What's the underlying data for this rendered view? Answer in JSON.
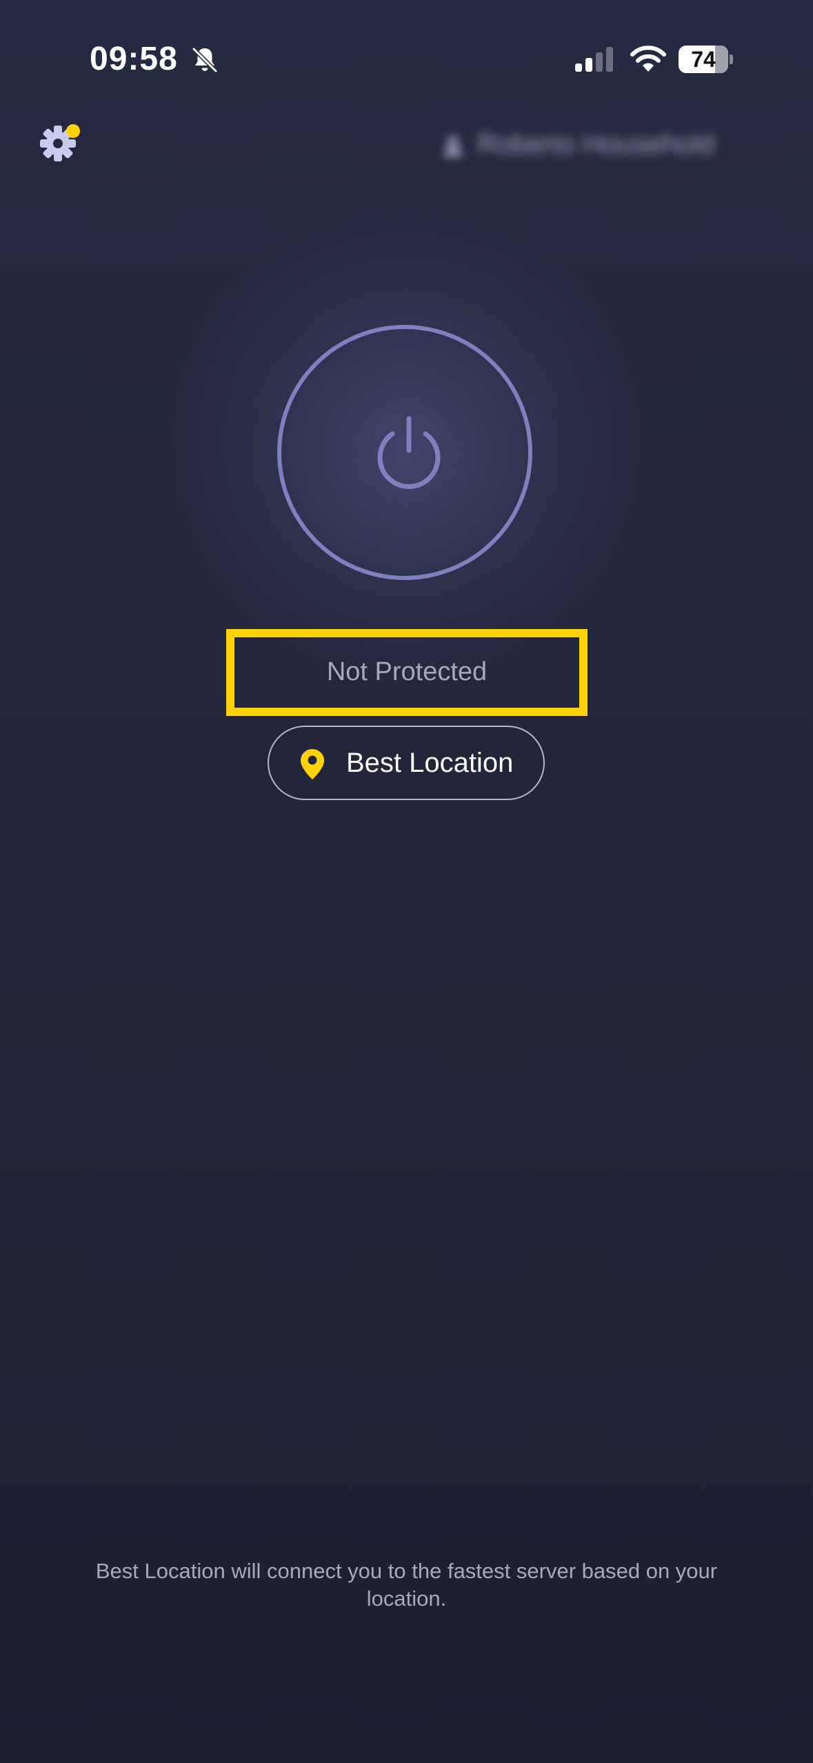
{
  "status_bar": {
    "time": "09:58",
    "battery_level": "74",
    "battery_fraction": 0.74,
    "icons": [
      "bell-slash-icon",
      "cellular-signal-icon",
      "wifi-icon",
      "battery-icon"
    ]
  },
  "header": {
    "settings_icon": "gear-icon",
    "has_notification": true,
    "account_label": "Roberto Household",
    "account_icon": "person-icon"
  },
  "main": {
    "power_icon": "power-icon",
    "status_text": "Not Protected",
    "location_icon": "map-pin-icon",
    "location_label": "Best Location"
  },
  "footer": {
    "hint": "Best Location will connect you to the fastest server based on your location."
  },
  "colors": {
    "background": "#232538",
    "accent_yellow": "#ffd20a",
    "power_ring": "#7f80be",
    "status_text": "#a6a8c0",
    "text_white": "#ffffff"
  }
}
